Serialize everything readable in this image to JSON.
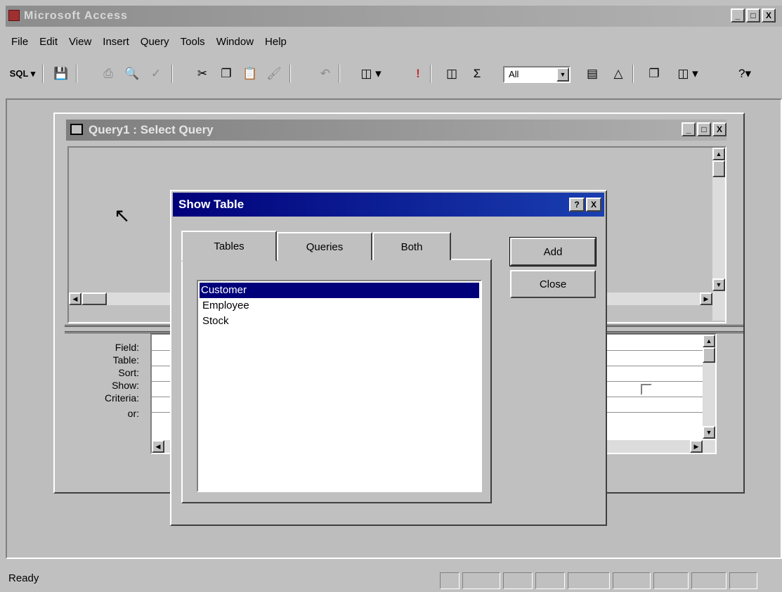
{
  "app": {
    "title": "Microsoft Access",
    "buttons": {
      "minimize": "_",
      "maximize": "□",
      "close": "X"
    }
  },
  "menu": [
    {
      "id": "file",
      "label": "File"
    },
    {
      "id": "edit",
      "label": "Edit"
    },
    {
      "id": "view",
      "label": "View"
    },
    {
      "id": "insert",
      "label": "Insert"
    },
    {
      "id": "query",
      "label": "Query"
    },
    {
      "id": "tools",
      "label": "Tools"
    },
    {
      "id": "window",
      "label": "Window"
    },
    {
      "id": "help",
      "label": "Help"
    }
  ],
  "toolbar": {
    "sql_label": "SQL ▾",
    "top_values": "All",
    "icons": [
      "save-icon",
      "print-icon",
      "print-preview-icon",
      "spelling-icon",
      "cut-icon",
      "copy-icon",
      "paste-icon",
      "format-painter-icon",
      "undo-icon",
      "query-type-icon",
      "run-icon",
      "show-table-icon",
      "totals-icon",
      "properties-icon",
      "build-icon",
      "database-window-icon",
      "new-object-icon",
      "help-icon"
    ]
  },
  "query_window": {
    "title": "Query1 : Select Query",
    "grid_labels": [
      "Field:",
      "Table:",
      "Sort:",
      "Show:",
      "Criteria:",
      "or:"
    ]
  },
  "dialog": {
    "title": "Show Table",
    "help": "?",
    "close": "X",
    "tabs": [
      {
        "id": "tables",
        "label": "Tables",
        "active": true
      },
      {
        "id": "queries",
        "label": "Queries",
        "active": false
      },
      {
        "id": "both",
        "label": "Both",
        "active": false
      }
    ],
    "tables": [
      {
        "name": "Customer",
        "selected": true
      },
      {
        "name": "Employee",
        "selected": false
      },
      {
        "name": "Stock",
        "selected": false
      }
    ],
    "add_label": "Add",
    "close_label": "Close"
  },
  "status": {
    "text": "Ready"
  }
}
